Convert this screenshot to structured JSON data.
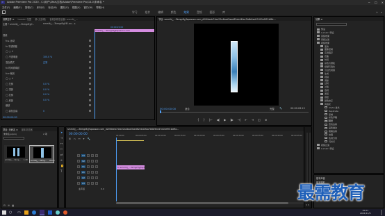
{
  "titlebar": {
    "logo": "Pr",
    "title": "Adobe Premiere Pro 2020 - C:\\用户\\Sfea\\文档\\Adobe\\Premiere Pro\\14.0\\未命名 *"
  },
  "menu": [
    "文件(F)",
    "编辑(E)",
    "剪辑(C)",
    "序列(S)",
    "标记(M)",
    "图形(G)",
    "视图(V)",
    "窗口(W)",
    "帮助(H)"
  ],
  "workspaces": {
    "tabs": [
      "学习",
      "组件",
      "编辑",
      "颜色",
      "效果",
      "音频",
      "图形",
      "库"
    ],
    "active_index": 4,
    "more": "»"
  },
  "effect_controls": {
    "tabs": [
      "效果控件 ≡",
      "Lumetri 范围",
      "源:(无剪辑)",
      "音频剪辑混合器: smmlkj_..."
    ],
    "clip_header": "主要 * smmlkj_...3kmgr8yjf...",
    "seq_header": "smmlkj_...3kmgr8yjf4f..ox... ▸",
    "timecode_mini": "00:00:20:00",
    "clip_strip_label": "smmlkj_...3kmgr8yjfspasson.com",
    "rows": [
      {
        "label": "视频",
        "value": ""
      },
      {
        "label": "fx ▸ 运动",
        "value": ""
      },
      {
        "label": "fx 不透明度",
        "value": ""
      },
      {
        "label": "◯ ▢ ✐",
        "value": ""
      },
      {
        "label": "◯ 不透明度",
        "value": "100.0 %"
      },
      {
        "label": "混合模式",
        "value": "正常"
      },
      {
        "label": "fx 时间重映射",
        "value": ""
      },
      {
        "label": "fx ▾ 裁剪",
        "value": ""
      },
      {
        "label": "◯ ▢ ✐",
        "value": ""
      },
      {
        "label": "◯ 左侧",
        "value": "0.0 %"
      },
      {
        "label": "◯ 顶部",
        "value": "0.0 %"
      },
      {
        "label": "◯ 右侧",
        "value": "0.0 %"
      },
      {
        "label": "◯ 底部",
        "value": "0.0 %"
      },
      {
        "label": "缩放",
        "value": ""
      },
      {
        "label": "◯ 羽化边缘",
        "value": "0"
      }
    ],
    "footer_time": "00:00:00:00"
  },
  "program": {
    "tab": "节目: smmlkj_...3kmgr8yjfspasson.com_d20fdeeb74ee22a4bad3aed62eb44faa7b6b9ed47d10e9f21bf8c...",
    "timecode": "00:00:00:00",
    "fit": "适合",
    "quality": "完整",
    "duration": "00:00:28:13",
    "controls": [
      "{",
      "}",
      "|←",
      "◀|",
      "▶",
      "|▶",
      "→|",
      "⇤",
      "⇥",
      "◫",
      "⊕"
    ]
  },
  "project": {
    "tabs": [
      "项目: 未命名 ≡",
      "媒体浏览器"
    ],
    "name": "未命名.prproj",
    "item_count": "2 项",
    "items": [
      {
        "name": "smmlkj_...3kmg...",
        "duration": "1:30"
      },
      {
        "name": "smmlkj_...3kmg...",
        "duration": "28:13"
      }
    ]
  },
  "timeline": {
    "tab": "smmlkj_...3kmgr8yjfspasson.com_d20fdeeb74ee22a4bad3aed62eb44faa7b6b9ed47d10e9f21bf8c...",
    "timecode": "00:00:00:00",
    "ruler": [
      "00:00:00",
      "00:00:05:00",
      "00:00:10:00",
      "00:00:15:00",
      "00:00:20:00",
      "00:00:25:00",
      "00:00:30:00",
      "00:00:35:00",
      "00:00:40:00",
      "00:00:45:00"
    ],
    "tracks": [
      "V3",
      "V2",
      "V1",
      "A1",
      "A2",
      "A3"
    ],
    "master": "主声道",
    "master_value": "0.0",
    "clip_label": "fx smmlkj_...3kmgr8yjfspasson"
  },
  "effects_panel": {
    "tab": "效果 ≡",
    "items": [
      "预设",
      "Lumetri 预设",
      "音频效果",
      "音频过渡",
      "视频效果",
      "变换",
      "图像控制",
      "实用程序",
      "扭曲",
      "时间",
      "杂色与颗粒",
      "模糊与锐化",
      "沉浸式视频",
      "生成",
      "视频",
      "调整",
      "过时",
      "过渡",
      "透视",
      "通道",
      "键控",
      "颜色校正",
      "风格化",
      "视频过渡",
      "Lumetri 预设"
    ],
    "cropping_children": [
      "Alpha 发光",
      "Replicate",
      "复制",
      "彩色浮雕",
      "曝光",
      "查找边缘",
      "画笔描边",
      "粗糙边缘",
      "纹理",
      "色调分离",
      "闪光灯"
    ]
  },
  "essential_sound": [
    "基本声音",
    "基本图形"
  ],
  "taskbar": {
    "time": "15:01",
    "date": "2021/11/9"
  },
  "watermark": "最需教育",
  "colors": {
    "accent": "#4d9df5",
    "clip": "#d48de0",
    "bg": "#1e1e1e"
  }
}
